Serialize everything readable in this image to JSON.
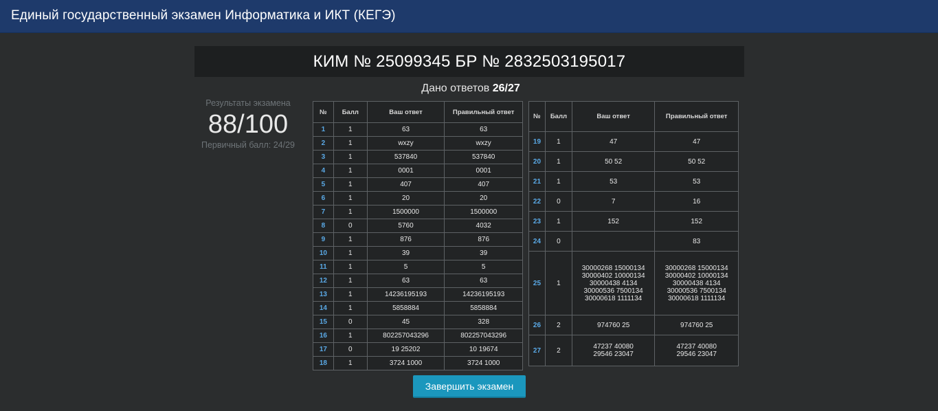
{
  "header": {
    "title": "Единый государственный экзамен Информатика и ИКТ (КЕГЭ)"
  },
  "kim": {
    "text": "КИМ № 25099345 БР № 2832503195017"
  },
  "answered": {
    "label": "Дано ответов",
    "value": "26/27"
  },
  "results": {
    "label": "Результаты экзамена",
    "score": "88/100",
    "primary": "Первичный балл: 24/29"
  },
  "table": {
    "headers": {
      "num": "№",
      "score": "Балл",
      "yours": "Ваш\nответ",
      "correct": "Правильный\nответ"
    },
    "left_rows": [
      {
        "num": "1",
        "score": "1",
        "yours": "63",
        "correct": "63"
      },
      {
        "num": "2",
        "score": "1",
        "yours": "wxzy",
        "correct": "wxzy"
      },
      {
        "num": "3",
        "score": "1",
        "yours": "537840",
        "correct": "537840"
      },
      {
        "num": "4",
        "score": "1",
        "yours": "0001",
        "correct": "0001"
      },
      {
        "num": "5",
        "score": "1",
        "yours": "407",
        "correct": "407"
      },
      {
        "num": "6",
        "score": "1",
        "yours": "20",
        "correct": "20"
      },
      {
        "num": "7",
        "score": "1",
        "yours": "1500000",
        "correct": "1500000"
      },
      {
        "num": "8",
        "score": "0",
        "yours": "5760",
        "correct": "4032"
      },
      {
        "num": "9",
        "score": "1",
        "yours": "876",
        "correct": "876"
      },
      {
        "num": "10",
        "score": "1",
        "yours": "39",
        "correct": "39"
      },
      {
        "num": "11",
        "score": "1",
        "yours": "5",
        "correct": "5"
      },
      {
        "num": "12",
        "score": "1",
        "yours": "63",
        "correct": "63"
      },
      {
        "num": "13",
        "score": "1",
        "yours": "14236195193",
        "correct": "14236195193"
      },
      {
        "num": "14",
        "score": "1",
        "yours": "5858884",
        "correct": "5858884"
      },
      {
        "num": "15",
        "score": "0",
        "yours": "45",
        "correct": "328"
      },
      {
        "num": "16",
        "score": "1",
        "yours": "802257043296",
        "correct": "802257043296"
      },
      {
        "num": "17",
        "score": "0",
        "yours": "19 25202",
        "correct": "10 19674"
      },
      {
        "num": "18",
        "score": "1",
        "yours": "3724 1000",
        "correct": "3724 1000"
      }
    ],
    "right_rows": [
      {
        "num": "19",
        "score": "1",
        "yours": "47",
        "correct": "47"
      },
      {
        "num": "20",
        "score": "1",
        "yours": "50 52",
        "correct": "50 52"
      },
      {
        "num": "21",
        "score": "1",
        "yours": "53",
        "correct": "53"
      },
      {
        "num": "22",
        "score": "0",
        "yours": "7",
        "correct": "16"
      },
      {
        "num": "23",
        "score": "1",
        "yours": "152",
        "correct": "152"
      },
      {
        "num": "24",
        "score": "0",
        "yours": "",
        "correct": "83"
      },
      {
        "num": "25",
        "score": "1",
        "yours": "30000268 15000134\n30000402 10000134\n30000438 4134\n30000536 7500134\n30000618 1111134",
        "correct": "30000268 15000134\n30000402 10000134\n30000438 4134\n30000536 7500134\n30000618 1111134"
      },
      {
        "num": "26",
        "score": "2",
        "yours": "974760 25",
        "correct": "974760 25"
      },
      {
        "num": "27",
        "score": "2",
        "yours": "47237 40080\n29546 23047",
        "correct": "47237 40080\n29546 23047"
      }
    ]
  },
  "finish_button": {
    "label": "Завершить экзамен"
  }
}
